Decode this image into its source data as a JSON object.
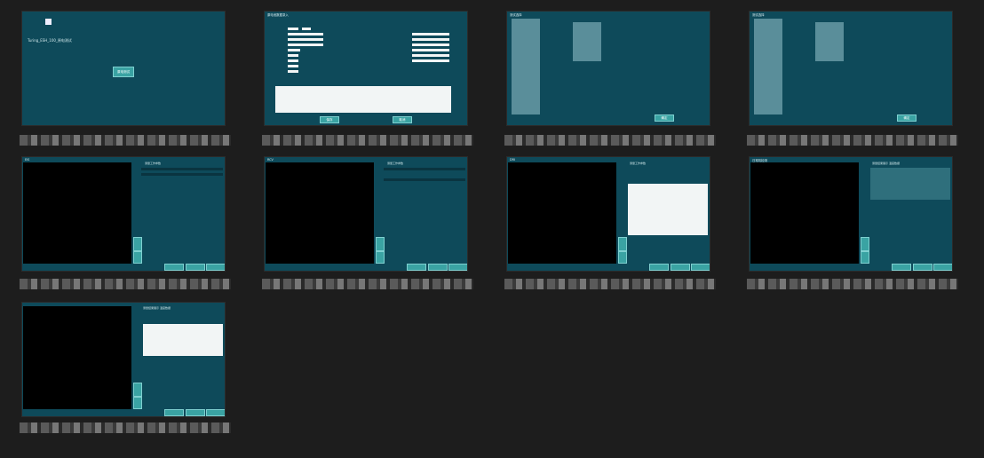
{
  "thumbs": [
    {
      "title": "",
      "logo_text": "Turing_ESH_100_原电测试",
      "button": "原电测试"
    },
    {
      "title": "原电池数据录入",
      "submit": "保存",
      "cancel": "取消"
    },
    {
      "title": "测试选择",
      "confirm": "确定"
    },
    {
      "title": "测试选择",
      "confirm": "确定"
    },
    {
      "title": "EIS",
      "panel_title": "测量工作参数"
    },
    {
      "title": "RCV",
      "panel_title": "测量工作参数"
    },
    {
      "title": "DRI",
      "panel_title": "测量工作参数"
    },
    {
      "title": "日常机检测",
      "panel_title": "测量结果展示 温度数据"
    },
    {
      "title": "",
      "panel_title": "测量结果展示 温度数据"
    }
  ]
}
